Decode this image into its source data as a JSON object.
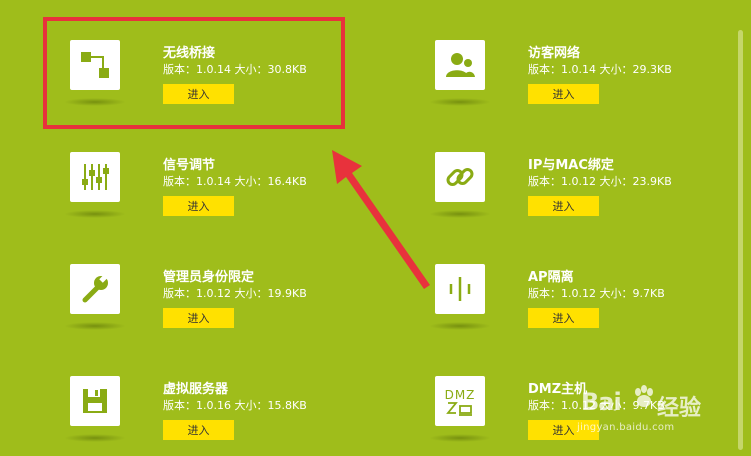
{
  "meta_prefix_version": "版本：",
  "meta_prefix_size": "大小：",
  "apps": [
    {
      "name": "无线桥接",
      "version": "1.0.14",
      "size": "30.8KB",
      "button": "进入",
      "icon": "bridge-icon"
    },
    {
      "name": "访客网络",
      "version": "1.0.14",
      "size": "29.3KB",
      "button": "进入",
      "icon": "guest-users-icon"
    },
    {
      "name": "信号调节",
      "version": "1.0.14",
      "size": "16.4KB",
      "button": "进入",
      "icon": "signal-sliders-icon"
    },
    {
      "name": "IP与MAC绑定",
      "version": "1.0.12",
      "size": "23.9KB",
      "button": "进入",
      "icon": "link-chain-icon"
    },
    {
      "name": "管理员身份限定",
      "version": "1.0.12",
      "size": "19.9KB",
      "button": "进入",
      "icon": "wrench-icon"
    },
    {
      "name": "AP隔离",
      "version": "1.0.12",
      "size": "9.7KB",
      "button": "进入",
      "icon": "ap-isolation-icon"
    },
    {
      "name": "虚拟服务器",
      "version": "1.0.16",
      "size": "15.8KB",
      "button": "进入",
      "icon": "floppy-disk-icon"
    },
    {
      "name": "DMZ主机",
      "version": "1.0.12",
      "size": "9.7KB",
      "button": "进入",
      "icon": "dmz-icon"
    }
  ],
  "dmz_glyph": "DMZ",
  "watermark": {
    "logo": "Bai",
    "logo_tail": "u",
    "cn": "经验",
    "url": "jingyan.baidu.com"
  },
  "colors": {
    "background": "#9fbd1b",
    "button": "#ffe100",
    "highlight": "#e8323c",
    "icon_fg": "#8aab14"
  }
}
